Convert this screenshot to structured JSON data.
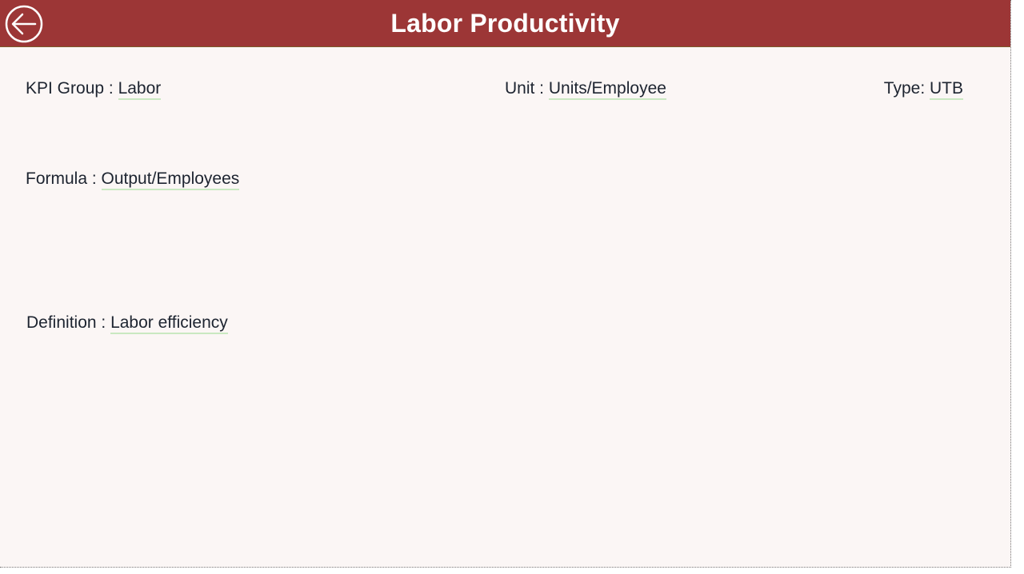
{
  "header": {
    "title": "Labor Productivity",
    "back_icon": "back-arrow-circle-icon",
    "background_color": "#9c3636"
  },
  "fields": {
    "kpi_group": {
      "label": "KPI Group : ",
      "value": "Labor"
    },
    "unit": {
      "label": "Unit : ",
      "value": "Units/Employee"
    },
    "type": {
      "label": "Type: ",
      "value": "UTB"
    },
    "formula": {
      "label": "Formula : ",
      "value": "Output/Employees"
    },
    "definition": {
      "label": "Definition : ",
      "value": "Labor efficiency"
    }
  }
}
